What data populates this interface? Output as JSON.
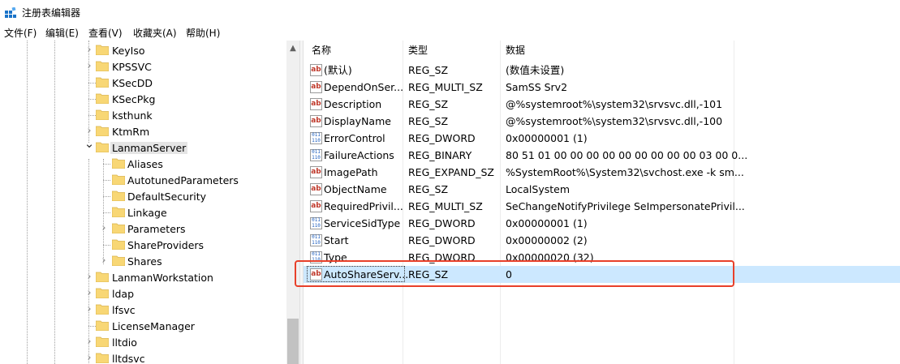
{
  "window": {
    "title": "注册表编辑器",
    "icon": "registry-editor-icon"
  },
  "menu": [
    "文件(F)",
    "编辑(E)",
    "查看(V)",
    "收藏夹(A)",
    "帮助(H)"
  ],
  "tree": {
    "nodes": [
      {
        "label": "KeyIso",
        "expander": "collapsed"
      },
      {
        "label": "KPSSVC",
        "expander": "collapsed"
      },
      {
        "label": "KSecDD",
        "expander": "none"
      },
      {
        "label": "KSecPkg",
        "expander": "none"
      },
      {
        "label": "ksthunk",
        "expander": "none"
      },
      {
        "label": "KtmRm",
        "expander": "collapsed"
      },
      {
        "label": "LanmanServer",
        "expander": "expanded",
        "selected": true
      },
      {
        "label": "Aliases",
        "expander": "none"
      },
      {
        "label": "AutotunedParameters",
        "expander": "none"
      },
      {
        "label": "DefaultSecurity",
        "expander": "none"
      },
      {
        "label": "Linkage",
        "expander": "none"
      },
      {
        "label": "Parameters",
        "expander": "collapsed"
      },
      {
        "label": "ShareProviders",
        "expander": "none"
      },
      {
        "label": "Shares",
        "expander": "collapsed"
      },
      {
        "label": "LanmanWorkstation",
        "expander": "collapsed"
      },
      {
        "label": "ldap",
        "expander": "collapsed"
      },
      {
        "label": "lfsvc",
        "expander": "collapsed"
      },
      {
        "label": "LicenseManager",
        "expander": "none"
      },
      {
        "label": "lltdio",
        "expander": "collapsed"
      },
      {
        "label": "lltdsvc",
        "expander": "collapsed"
      }
    ]
  },
  "list": {
    "columns": [
      "名称",
      "类型",
      "数据"
    ],
    "rows": [
      {
        "icon": "ab",
        "name": "(默认)",
        "type": "REG_SZ",
        "data": "(数值未设置)"
      },
      {
        "icon": "ab",
        "name": "DependOnSer...",
        "type": "REG_MULTI_SZ",
        "data": "SamSS Srv2"
      },
      {
        "icon": "ab",
        "name": "Description",
        "type": "REG_SZ",
        "data": "@%systemroot%\\system32\\srvsvc.dll,-101"
      },
      {
        "icon": "ab",
        "name": "DisplayName",
        "type": "REG_SZ",
        "data": "@%systemroot%\\system32\\srvsvc.dll,-100"
      },
      {
        "icon": "bin",
        "name": "ErrorControl",
        "type": "REG_DWORD",
        "data": "0x00000001 (1)"
      },
      {
        "icon": "bin",
        "name": "FailureActions",
        "type": "REG_BINARY",
        "data": "80 51 01 00 00 00 00 00 00 00 00 00 03 00 0..."
      },
      {
        "icon": "ab",
        "name": "ImagePath",
        "type": "REG_EXPAND_SZ",
        "data": "%SystemRoot%\\System32\\svchost.exe -k sm..."
      },
      {
        "icon": "ab",
        "name": "ObjectName",
        "type": "REG_SZ",
        "data": "LocalSystem"
      },
      {
        "icon": "ab",
        "name": "RequiredPrivil...",
        "type": "REG_MULTI_SZ",
        "data": "SeChangeNotifyPrivilege SeImpersonatePrivil..."
      },
      {
        "icon": "bin",
        "name": "ServiceSidType",
        "type": "REG_DWORD",
        "data": "0x00000001 (1)"
      },
      {
        "icon": "bin",
        "name": "Start",
        "type": "REG_DWORD",
        "data": "0x00000002 (2)"
      },
      {
        "icon": "bin",
        "name": "Type",
        "type": "REG_DWORD",
        "data": "0x00000020 (32)"
      },
      {
        "icon": "ab",
        "name": "AutoShareServ...",
        "type": "REG_SZ",
        "data": "0",
        "selected": true
      }
    ]
  },
  "icon_glyphs": {
    "ab": "ab",
    "bin": "011\n110"
  },
  "colors": {
    "selection": "#cce8ff",
    "annotation": "#e8402a",
    "folder": "#f8d775"
  }
}
